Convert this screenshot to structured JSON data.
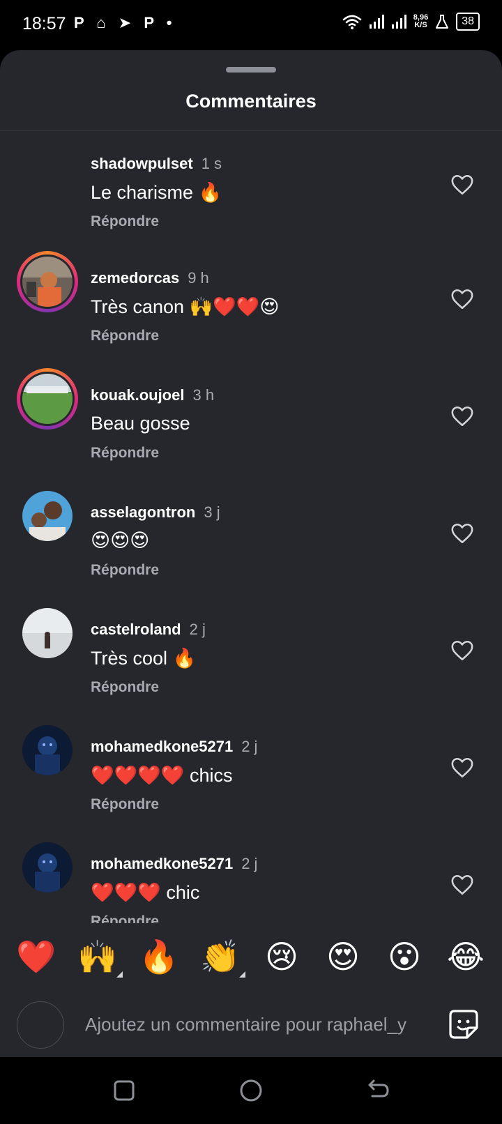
{
  "status_bar": {
    "time": "18:57",
    "notification_icons": "P ⌂ ➤ P •",
    "net_speed_value": "8,96",
    "net_speed_unit": "K/S",
    "battery": "38"
  },
  "sheet": {
    "title": "Commentaires"
  },
  "comments": [
    {
      "username": "shadowpulset",
      "time": "1 s",
      "text": "Le charisme 🔥",
      "reply_label": "Répondre",
      "avatar_ring": false
    },
    {
      "username": "zemedorcas",
      "time": "9 h",
      "text": "Très canon 🙌❤️❤️😍",
      "reply_label": "Répondre",
      "avatar_ring": true
    },
    {
      "username": "kouak.oujoel",
      "time": "3 h",
      "text": "Beau gosse",
      "reply_label": "Répondre",
      "avatar_ring": true
    },
    {
      "username": "asselagontron",
      "time": "3 j",
      "text": "😍😍😍",
      "reply_label": "Répondre",
      "avatar_ring": false
    },
    {
      "username": "castelroland",
      "time": "2 j",
      "text": "Très cool 🔥",
      "reply_label": "Répondre",
      "avatar_ring": false
    },
    {
      "username": "mohamedkone5271",
      "time": "2 j",
      "text": "❤️❤️❤️❤️ chics",
      "reply_label": "Répondre",
      "avatar_ring": false
    },
    {
      "username": "mohamedkone5271",
      "time": "2 j",
      "text": "❤️❤️❤️ chic",
      "reply_label": "Répondre",
      "avatar_ring": false
    }
  ],
  "reactions": [
    "❤️",
    "🙌",
    "🔥",
    "👏",
    "😢",
    "😍",
    "😮",
    "😂"
  ],
  "composer": {
    "placeholder": "Ajoutez un commentaire pour raphael_y"
  },
  "icons": {
    "like": "heart-outline-icon",
    "sticker": "sticker-icon",
    "nav": [
      "recent-apps-icon",
      "home-icon",
      "back-icon"
    ]
  },
  "colors": {
    "sheet_bg": "#25272c",
    "secondary_text": "#a8abb1",
    "story_ring_start": "#f58529",
    "story_ring_end": "#dd2a7b"
  }
}
